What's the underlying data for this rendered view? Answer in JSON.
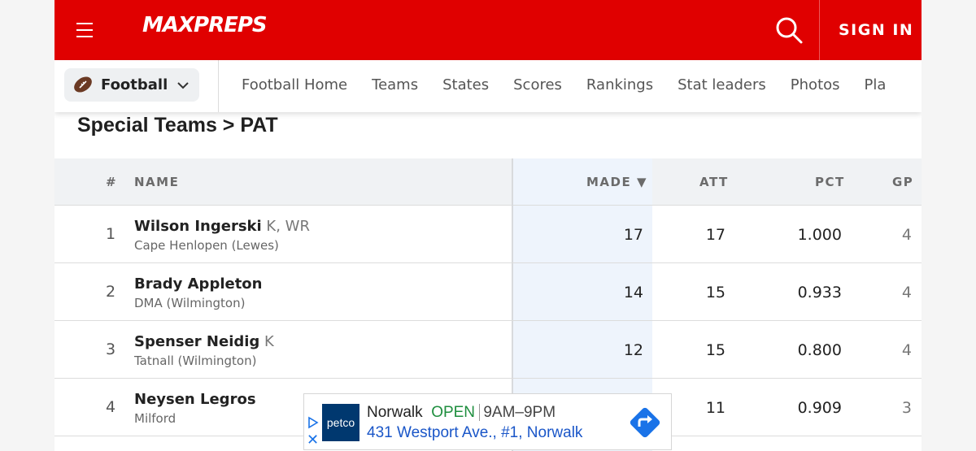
{
  "header": {
    "logo": "MAXPREPS",
    "signin": "SIGN IN",
    "brand_color": "#e00000"
  },
  "subnav": {
    "sport": "Football",
    "items": [
      "Football Home",
      "Teams",
      "States",
      "Scores",
      "Rankings",
      "Stat leaders",
      "Photos",
      "Pla"
    ]
  },
  "page": {
    "title": "Special Teams > PAT"
  },
  "table": {
    "headers": {
      "rank": "#",
      "name": "NAME",
      "made": "MADE ▼",
      "att": "ATT",
      "pct": "PCT",
      "gp": "GP"
    },
    "rows": [
      {
        "rank": "1",
        "name": "Wilson Ingerski",
        "pos": " K, WR",
        "school": "Cape Henlopen (Lewes)",
        "made": "17",
        "att": "17",
        "pct": "1.000",
        "gp": "4"
      },
      {
        "rank": "2",
        "name": "Brady Appleton",
        "pos": "",
        "school": "DMA (Wilmington)",
        "made": "14",
        "att": "15",
        "pct": "0.933",
        "gp": "4"
      },
      {
        "rank": "3",
        "name": "Spenser Neidig",
        "pos": " K",
        "school": "Tatnall (Wilmington)",
        "made": "12",
        "att": "15",
        "pct": "0.800",
        "gp": "4"
      },
      {
        "rank": "4",
        "name": "Neysen Legros",
        "pos": "",
        "school": "Milford",
        "made": "",
        "att": "11",
        "pct": "0.909",
        "gp": "3"
      }
    ]
  },
  "ad": {
    "logo": "petco",
    "store": "Norwalk",
    "status": "OPEN",
    "hours": "9AM–9PM",
    "address": "431 Westport Ave., #1, Norwalk",
    "close": "✕"
  }
}
